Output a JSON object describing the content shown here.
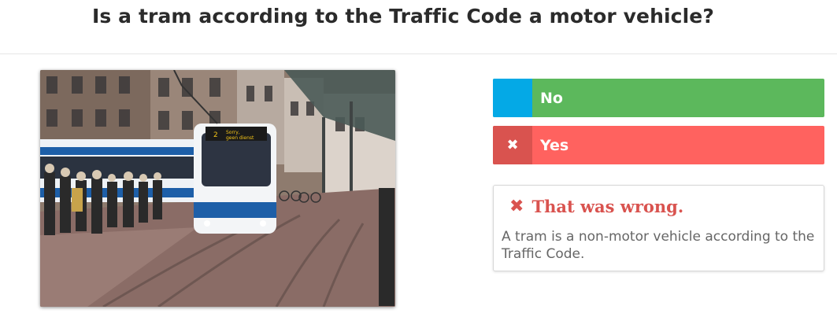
{
  "question": {
    "title": "Is a tram according to the Traffic Code a motor vehicle?"
  },
  "image": {
    "description": "Tram on a city street",
    "tram_sign": [
      "Sorry,",
      "geen dienst"
    ],
    "tram_number": "2"
  },
  "answers": [
    {
      "label": "No",
      "marker_icon": "",
      "marker_color": "#04a9e6",
      "color": "#5cb85c",
      "state": "correct"
    },
    {
      "label": "Yes",
      "marker_icon": "✖",
      "marker_color": "#d9534f",
      "color": "#ff625f",
      "state": "selected-wrong"
    }
  ],
  "feedback": {
    "icon": "✖",
    "title": "That was wrong.",
    "text": "A tram is a non-motor vehicle according to the Traffic Code."
  }
}
